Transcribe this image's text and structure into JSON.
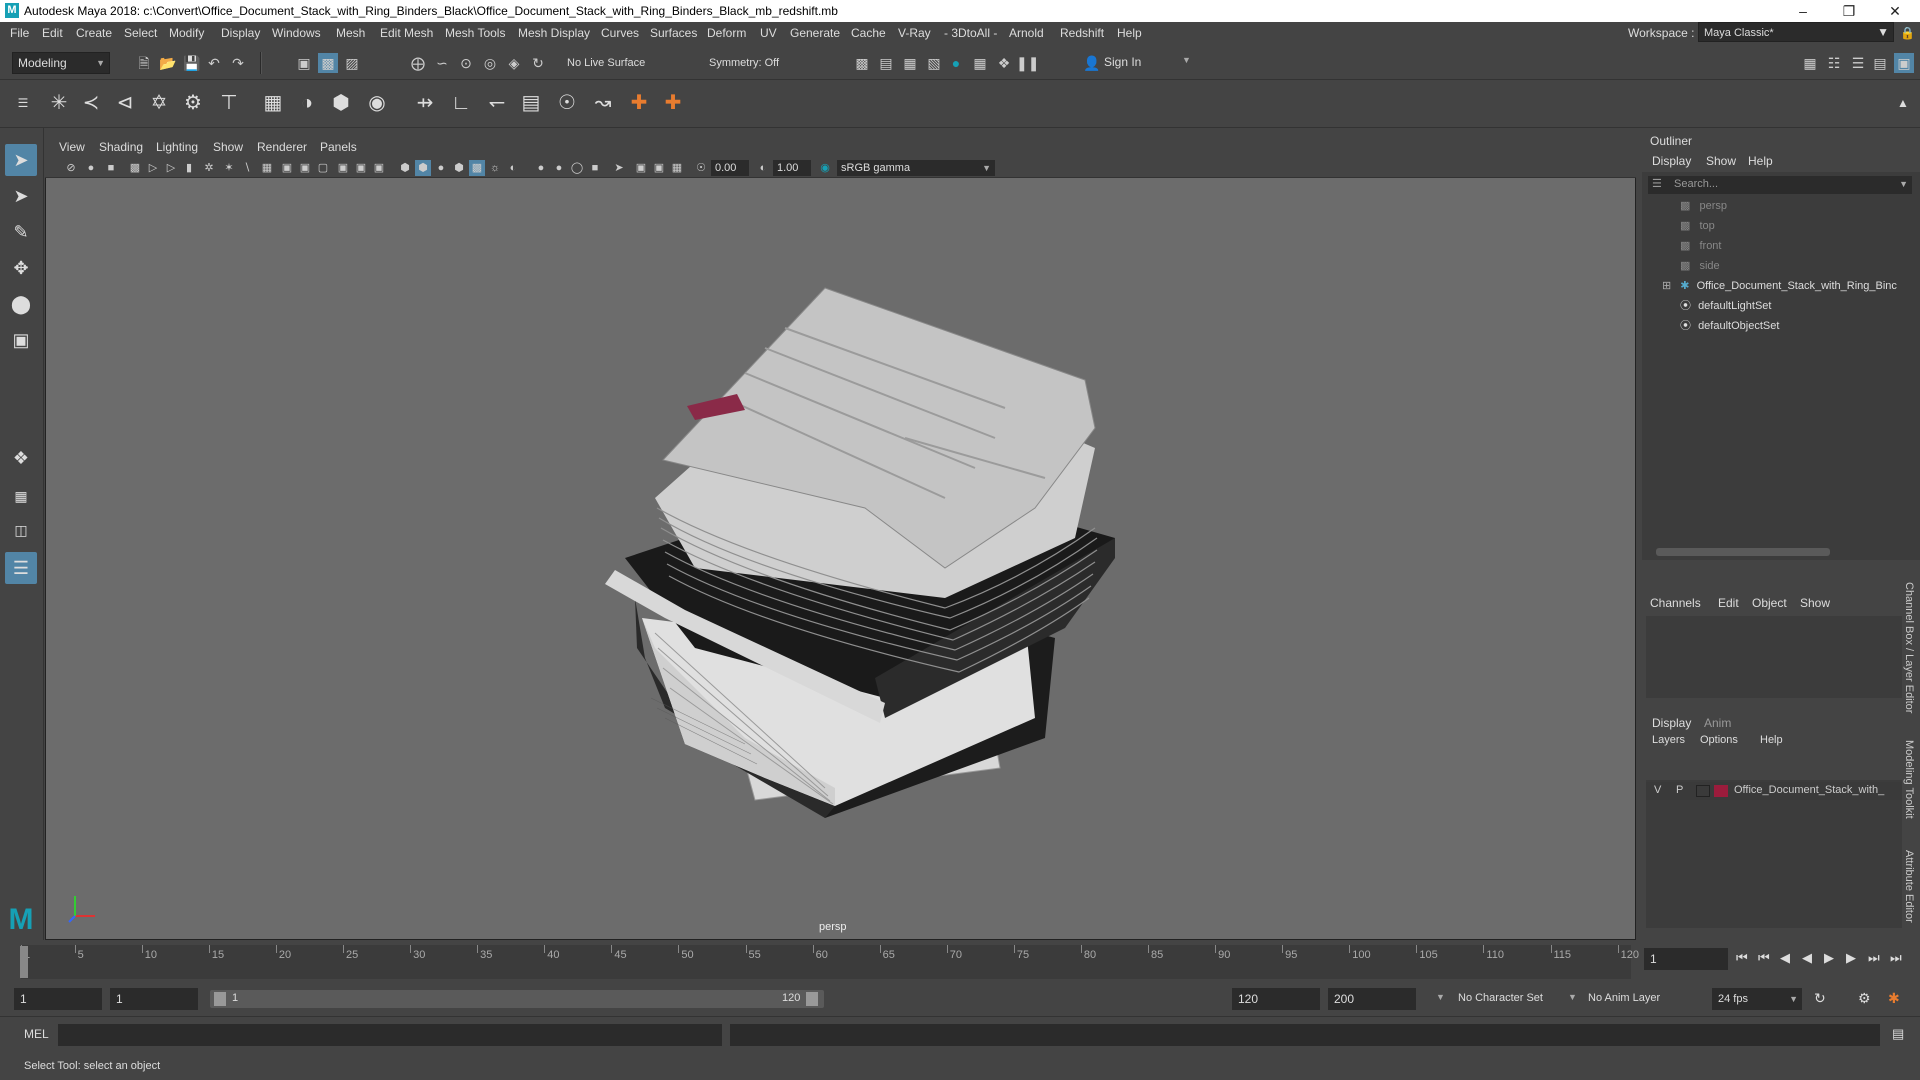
{
  "app": {
    "window_title": "Autodesk Maya 2018: c:\\Convert\\Office_Document_Stack_with_Ring_Binders_Black\\Office_Document_Stack_with_Ring_Binders_Black_mb_redshift.mb"
  },
  "menubar": [
    "File",
    "Edit",
    "Create",
    "Select",
    "Modify",
    "Display",
    "Windows",
    "Mesh",
    "Edit Mesh",
    "Mesh Tools",
    "Mesh Display",
    "Curves",
    "Surfaces",
    "Deform",
    "UV",
    "Generate",
    "Cache",
    "V-Ray",
    "- 3DtoAll -",
    "Arnold",
    "Redshift",
    "Help"
  ],
  "workspace": {
    "label": "Workspace :",
    "value": "Maya Classic*"
  },
  "statusline": {
    "mode": "Modeling",
    "live_surface": "No Live Surface",
    "symmetry": "Symmetry: Off",
    "sign_in": "Sign In"
  },
  "viewport": {
    "menu": [
      "View",
      "Shading",
      "Lighting",
      "Show",
      "Renderer",
      "Panels"
    ],
    "exposure": "0.00",
    "gamma": "1.00",
    "color_space": "sRGB gamma",
    "camera_label": "persp"
  },
  "outliner": {
    "title": "Outliner",
    "menu": [
      "Display",
      "Show",
      "Help"
    ],
    "search_placeholder": "Search...",
    "items": [
      {
        "label": "persp",
        "icon": "camera-icon",
        "dim": true
      },
      {
        "label": "top",
        "icon": "camera-icon",
        "dim": true
      },
      {
        "label": "front",
        "icon": "camera-icon",
        "dim": true
      },
      {
        "label": "side",
        "icon": "camera-icon",
        "dim": true
      },
      {
        "label": "Office_Document_Stack_with_Ring_Binc",
        "icon": "group-icon",
        "dim": false
      },
      {
        "label": "defaultLightSet",
        "icon": "set-icon",
        "dim": false
      },
      {
        "label": "defaultObjectSet",
        "icon": "set-icon",
        "dim": false
      }
    ]
  },
  "channel_box": {
    "menu": [
      "Channels",
      "Edit",
      "Object",
      "Show"
    ]
  },
  "layer_editor": {
    "tabs": [
      "Display",
      "Anim"
    ],
    "menu": [
      "Layers",
      "Options",
      "Help"
    ],
    "layer": {
      "v": "V",
      "p": "P",
      "name": "Office_Document_Stack_with_",
      "color": "#9b1c3c"
    }
  },
  "side_tabs": [
    "Channel Box / Layer Editor",
    "Modeling Toolkit",
    "Attribute Editor"
  ],
  "timeline": {
    "ticks": [
      1,
      5,
      10,
      15,
      20,
      25,
      30,
      35,
      40,
      45,
      50,
      55,
      60,
      65,
      70,
      75,
      80,
      85,
      90,
      95,
      100,
      105,
      110,
      115,
      120
    ],
    "current_frame": "1"
  },
  "range": {
    "start": "1",
    "inner_start": "1",
    "slider_start": "1",
    "slider_end": "120",
    "inner_end": "120",
    "end": "200",
    "character_set": "No Character Set",
    "anim_layer": "No Anim Layer",
    "fps": "24 fps"
  },
  "cmdline": {
    "label": "MEL"
  },
  "helpline": {
    "text": "Select Tool: select an object"
  },
  "colors": {
    "accent": "#5285a6",
    "layer_color": "#9b1c3c"
  }
}
